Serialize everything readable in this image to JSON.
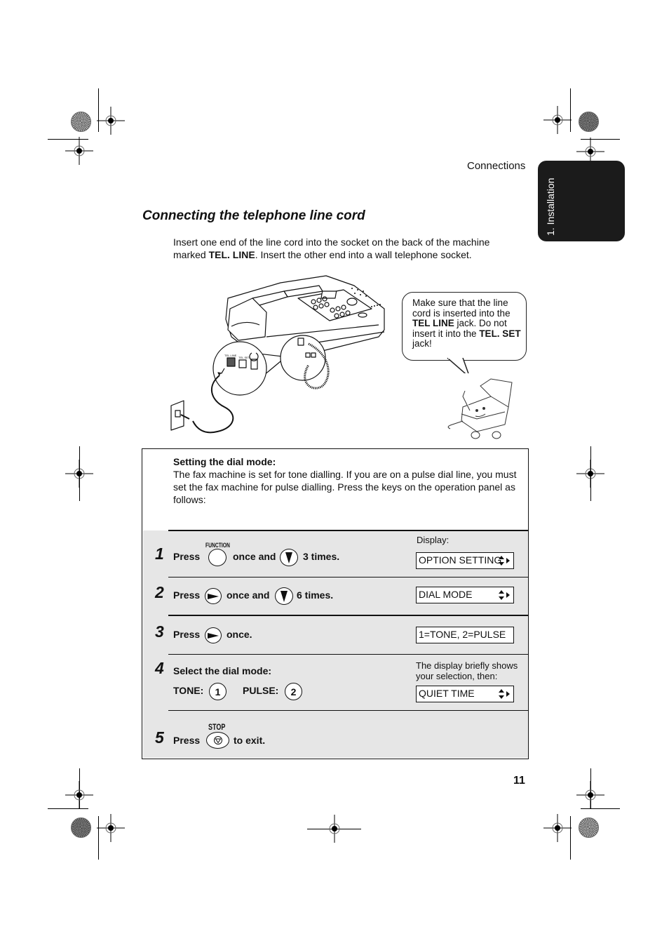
{
  "header": {
    "section": "Connections",
    "side_tab": "1. Installation"
  },
  "section_title": "Connecting the telephone line cord",
  "intro": {
    "part1": "Insert one end of the line cord into the socket on the back of the machine marked ",
    "bold": "TEL. LINE",
    "part2": ". Insert the other end into a wall telephone socket."
  },
  "illustration": {
    "subject": "fax-machine-with-line-cord",
    "jack_labels": [
      "TEL. LINE",
      "TEL. SET"
    ],
    "callout": {
      "t1": "Make sure that the line cord is inserted into the ",
      "b1": "TEL LINE",
      "t2": " jack. Do not insert it into the ",
      "b2": "TEL. SET",
      "t3": " jack!"
    }
  },
  "panel": {
    "lead": "Setting the dial mode:",
    "body": "The fax machine is set for tone dialling. If you are on a pulse dial line, you must set the fax machine for pulse dialling. Press the keys on the operation panel as follows:"
  },
  "steps": [
    {
      "num": "1",
      "press": "Press",
      "key1_label": "FUNCTION",
      "mid": "once and",
      "end": "3 times.",
      "display_label": "Display:",
      "display": "OPTION SETTING"
    },
    {
      "num": "2",
      "press": "Press",
      "mid": "once and",
      "end": "6 times.",
      "display": "DIAL MODE"
    },
    {
      "num": "3",
      "press": "Press",
      "end": "once.",
      "display": "1=TONE, 2=PULSE"
    },
    {
      "num": "4",
      "text": "Select the dial mode:",
      "tone_label": "TONE:",
      "tone_key": "1",
      "pulse_label": "PULSE:",
      "pulse_key": "2",
      "display_label": "The display briefly shows your selection, then:",
      "display": "QUIET TIME"
    },
    {
      "num": "5",
      "press": "Press",
      "key_label": "STOP",
      "end": "to exit."
    }
  ],
  "page_number": "11"
}
